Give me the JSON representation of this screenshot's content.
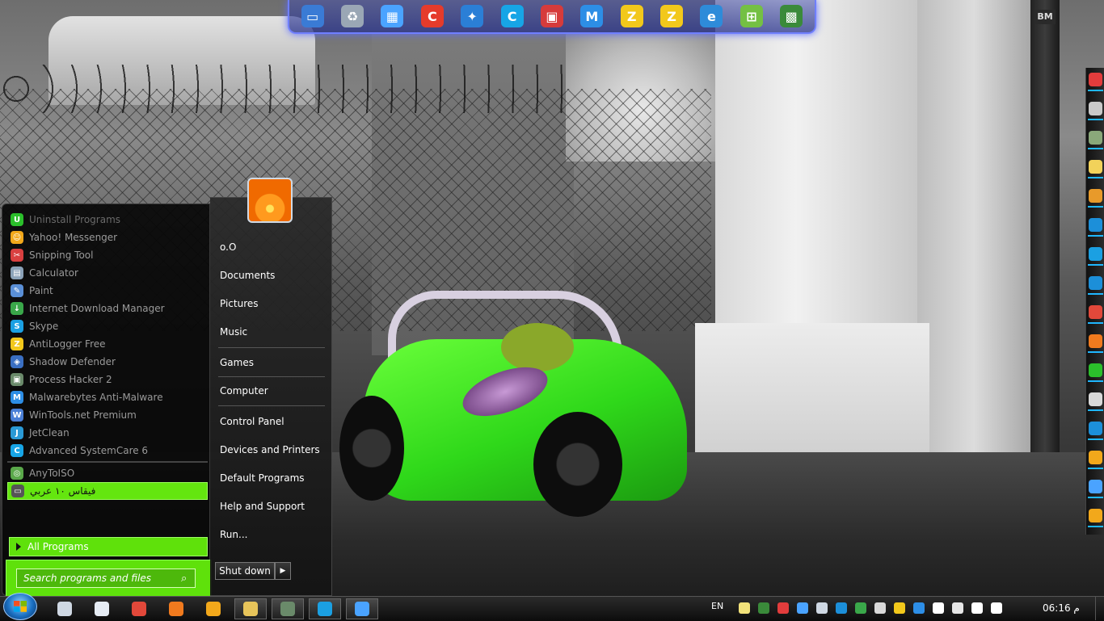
{
  "dock": {
    "items": [
      {
        "name": "computer-icon",
        "color": "#3a7bd5",
        "glyph": "▭"
      },
      {
        "name": "recycle-bin-icon",
        "color": "#9aa7b5",
        "glyph": "♻"
      },
      {
        "name": "network-icon",
        "color": "#4aa3ff",
        "glyph": "▦"
      },
      {
        "name": "ccleaner-icon",
        "color": "#e53b2b",
        "glyph": "C"
      },
      {
        "name": "tool-icon",
        "color": "#2b7fd6",
        "glyph": "✦"
      },
      {
        "name": "advanced-systemcare-icon",
        "color": "#17a5e6",
        "glyph": "C"
      },
      {
        "name": "monitor-icon",
        "color": "#d63b3b",
        "glyph": "▣"
      },
      {
        "name": "malwarebytes-icon",
        "color": "#2d8ee6",
        "glyph": "M"
      },
      {
        "name": "antilogger-icon",
        "color": "#f2c81b",
        "glyph": "Z"
      },
      {
        "name": "zemana-icon",
        "color": "#f2c81b",
        "glyph": "Z"
      },
      {
        "name": "internet-explorer-icon",
        "color": "#2e8bd9",
        "glyph": "e"
      },
      {
        "name": "windows-tools-icon",
        "color": "#74c043",
        "glyph": "⊞"
      },
      {
        "name": "task-manager-icon",
        "color": "#3a8a3a",
        "glyph": "▩"
      }
    ]
  },
  "start_menu": {
    "programs": [
      {
        "label": "Uninstall Programs",
        "icon": "uninstall-icon",
        "color": "#2bbf2b",
        "glyph": "U",
        "style": "faded"
      },
      {
        "label": "Yahoo! Messenger",
        "icon": "yahoo-messenger-icon",
        "color": "#f2a81b",
        "glyph": "☺",
        "style": ""
      },
      {
        "label": "Snipping Tool",
        "icon": "snipping-tool-icon",
        "color": "#d94040",
        "glyph": "✂",
        "style": ""
      },
      {
        "label": "Calculator",
        "icon": "calculator-icon",
        "color": "#8ba2b8",
        "glyph": "▤",
        "style": ""
      },
      {
        "label": "Paint",
        "icon": "paint-icon",
        "color": "#5a8fd6",
        "glyph": "✎",
        "style": ""
      },
      {
        "label": "Internet Download Manager",
        "icon": "idm-icon",
        "color": "#3aa84a",
        "glyph": "↓",
        "style": ""
      },
      {
        "label": "Skype",
        "icon": "skype-icon",
        "color": "#1ba0e2",
        "glyph": "S",
        "style": ""
      },
      {
        "label": "AntiLogger Free",
        "icon": "antilogger-icon",
        "color": "#f2c81b",
        "glyph": "Z",
        "style": ""
      },
      {
        "label": "Shadow Defender",
        "icon": "shadow-defender-icon",
        "color": "#3a6fc2",
        "glyph": "◈",
        "style": ""
      },
      {
        "label": "Process Hacker 2",
        "icon": "process-hacker-icon",
        "color": "#6a8a6a",
        "glyph": "▣",
        "style": ""
      },
      {
        "label": "Malwarebytes Anti-Malware",
        "icon": "malwarebytes-icon",
        "color": "#2d8ee6",
        "glyph": "M",
        "style": ""
      },
      {
        "label": "WinTools.net Premium",
        "icon": "wintools-icon",
        "color": "#4a7fd6",
        "glyph": "W",
        "style": ""
      },
      {
        "label": "JetClean",
        "icon": "jetclean-icon",
        "color": "#2a9ad6",
        "glyph": "J",
        "style": ""
      },
      {
        "label": "Advanced SystemCare 6",
        "icon": "advanced-systemcare-icon",
        "color": "#17a5e6",
        "glyph": "C",
        "style": ""
      }
    ],
    "pinned_after_sep": [
      {
        "label": "AnyToISO",
        "icon": "anytoiso-icon",
        "color": "#5aa84a",
        "glyph": "◎",
        "style": ""
      },
      {
        "label": "فيقاس ١٠ عربي",
        "icon": "arabic-app-icon",
        "color": "#555",
        "glyph": "▭",
        "style": "sel"
      }
    ],
    "all_programs": "All Programs",
    "search_placeholder": "Search programs and files",
    "right_links": [
      {
        "label": "o.O",
        "name": "user-name-link"
      },
      {
        "label": "Documents",
        "name": "documents-link"
      },
      {
        "label": "Pictures",
        "name": "pictures-link"
      },
      {
        "label": "Music",
        "name": "music-link"
      },
      {
        "label": "Games",
        "name": "games-link"
      },
      {
        "label": "Computer",
        "name": "computer-link"
      },
      {
        "label": "Control Panel",
        "name": "control-panel-link"
      },
      {
        "label": "Devices and Printers",
        "name": "devices-printers-link"
      },
      {
        "label": "Default Programs",
        "name": "default-programs-link"
      },
      {
        "label": "Help and Support",
        "name": "help-support-link"
      },
      {
        "label": "Run...",
        "name": "run-link"
      }
    ],
    "shutdown_label": "Shut down"
  },
  "taskbar": {
    "buttons": [
      {
        "name": "taskbar-notes",
        "color": "#cfd8e3",
        "active": false
      },
      {
        "name": "taskbar-document",
        "color": "#e6ecf4",
        "active": false
      },
      {
        "name": "taskbar-chrome",
        "color": "#e2483a",
        "active": false
      },
      {
        "name": "taskbar-firefox",
        "color": "#f07a1e",
        "active": false
      },
      {
        "name": "taskbar-yahoo",
        "color": "#f2a81b",
        "active": false
      },
      {
        "name": "taskbar-explorer",
        "color": "#e7c45a",
        "active": true
      },
      {
        "name": "taskbar-process-hacker",
        "color": "#6a8a6a",
        "active": true
      },
      {
        "name": "taskbar-skype",
        "color": "#1ba0e2",
        "active": true
      },
      {
        "name": "taskbar-remote",
        "color": "#4aa3ff",
        "active": true
      }
    ],
    "language": "EN",
    "clock": "06:16 م"
  },
  "tray_icons": [
    "note-icon",
    "monitor-icon",
    "flag-red-icon",
    "bluetooth-icon",
    "network-tray-icon",
    "shield-icon",
    "idm-icon",
    "update-icon",
    "antilogger-icon",
    "malwarebytes-icon",
    "action-center-flag-icon",
    "battery-icon",
    "signal-icon",
    "volume-icon"
  ],
  "side_bar_icons": [
    "opera-icon",
    "gear-icon",
    "chart-icon",
    "notes-icon",
    "jigsaw-icon",
    "calendar-icon",
    "skype-icon",
    "teamviewer-icon",
    "chrome-icon",
    "firefox-icon",
    "uninstall-icon",
    "disk-icon",
    "ccleaner-icon",
    "folder-icon",
    "world-icon",
    "paint-icon"
  ]
}
